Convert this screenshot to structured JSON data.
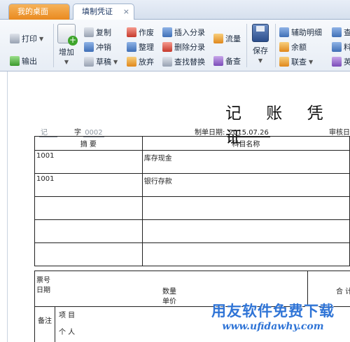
{
  "tabs": [
    {
      "label": "我的桌面"
    },
    {
      "label": "填制凭证",
      "close": "×"
    }
  ],
  "toolbar": {
    "print": "打印",
    "export": "输出",
    "add": "增加",
    "copy": "复制",
    "reverse": "冲销",
    "draft": "草稿",
    "void": "作废",
    "tidy": "整理",
    "abandon": "放弃",
    "insert_entry": "插入分录",
    "delete_entry": "删除分录",
    "find_replace": "查找替换",
    "flow": "流量",
    "check": "备查",
    "save": "保存",
    "aux_detail": "辅助明细",
    "balance": "余额",
    "query": "联查",
    "col_cha": "查",
    "col_liao": "料",
    "col_ying": "英"
  },
  "voucher": {
    "title": "记 账 凭 证",
    "type_label": "记",
    "zi_label": "字",
    "number": "0002",
    "date_label": "制单日期:",
    "date": "2015.07.26",
    "review_label": "审核日",
    "col_summary": "摘 要",
    "col_account": "科目名称",
    "rows": [
      {
        "summary": "1001",
        "account": "库存现金"
      },
      {
        "summary": "1001",
        "account": "银行存款"
      },
      {
        "summary": "",
        "account": ""
      },
      {
        "summary": "",
        "account": ""
      },
      {
        "summary": "",
        "account": ""
      }
    ],
    "ticket_label": "票号",
    "date_label2": "日期",
    "qty_label": "数量",
    "price_label": "单价",
    "total_label": "合 计",
    "remark_label": "备注",
    "item_label": "项 目",
    "person_label": "个 人"
  },
  "watermark": {
    "line1": "用友软件免费下载",
    "line2": "www.ufidawhy.com"
  }
}
